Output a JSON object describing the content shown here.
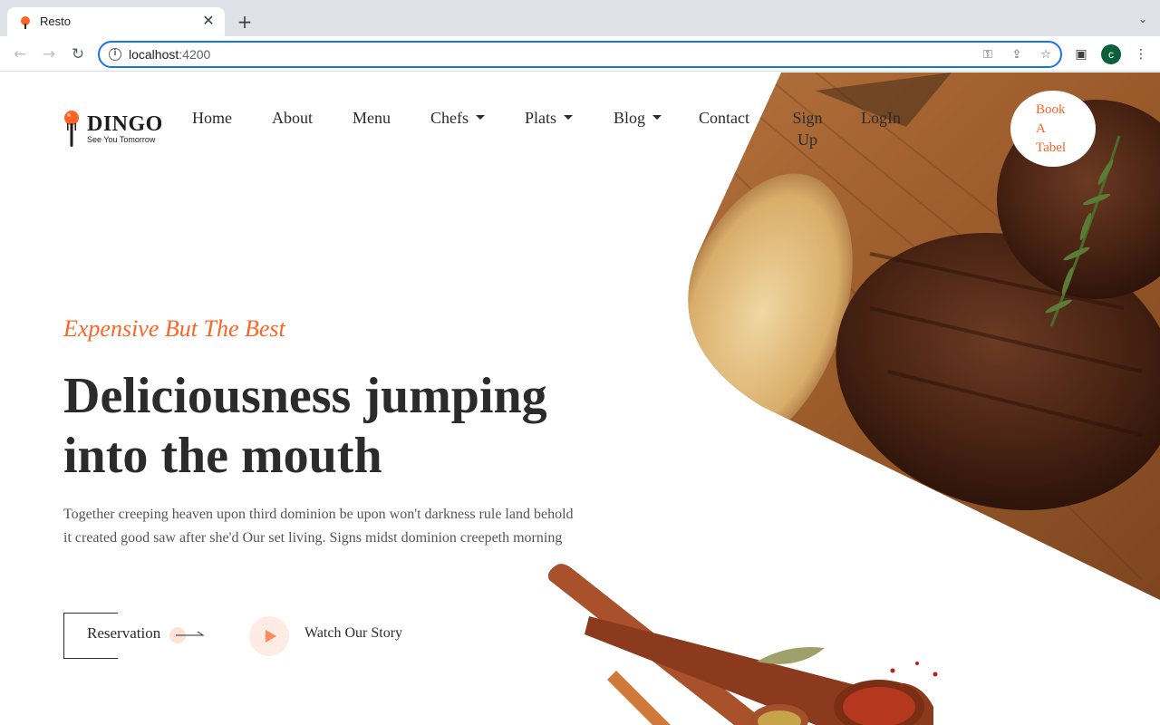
{
  "browser": {
    "tab_title": "Resto",
    "url_host": "localhost",
    "url_port": ":4200",
    "profile_initial": "c"
  },
  "header": {
    "logo_name": "DINGO",
    "logo_tagline": "See You Tomorrow",
    "nav": {
      "home": "Home",
      "about": "About",
      "menu": "Menu",
      "chefs": "Chefs",
      "plats": "Plats",
      "blog": "Blog",
      "contact": "Contact",
      "signup_line1": "Sign",
      "signup_line2": "Up",
      "login": "LogIn"
    },
    "book_line1": "Book",
    "book_line2": "A",
    "book_line3": "Tabel"
  },
  "hero": {
    "tagline": "Expensive But The Best",
    "headline_line1": "Deliciousness jumping",
    "headline_line2": "into the mouth",
    "description": "Together creeping heaven upon third dominion be upon won't darkness rule land behold it created good saw after she'd Our set living. Signs midst dominion creepeth morning",
    "reservation_label": "Reservation",
    "watch_label": "Watch Our Story"
  },
  "colors": {
    "accent": "#ff6426",
    "text_dark": "#2b2b2b",
    "chrome_bg": "#dee1e6",
    "url_focus": "#1a73e8"
  }
}
